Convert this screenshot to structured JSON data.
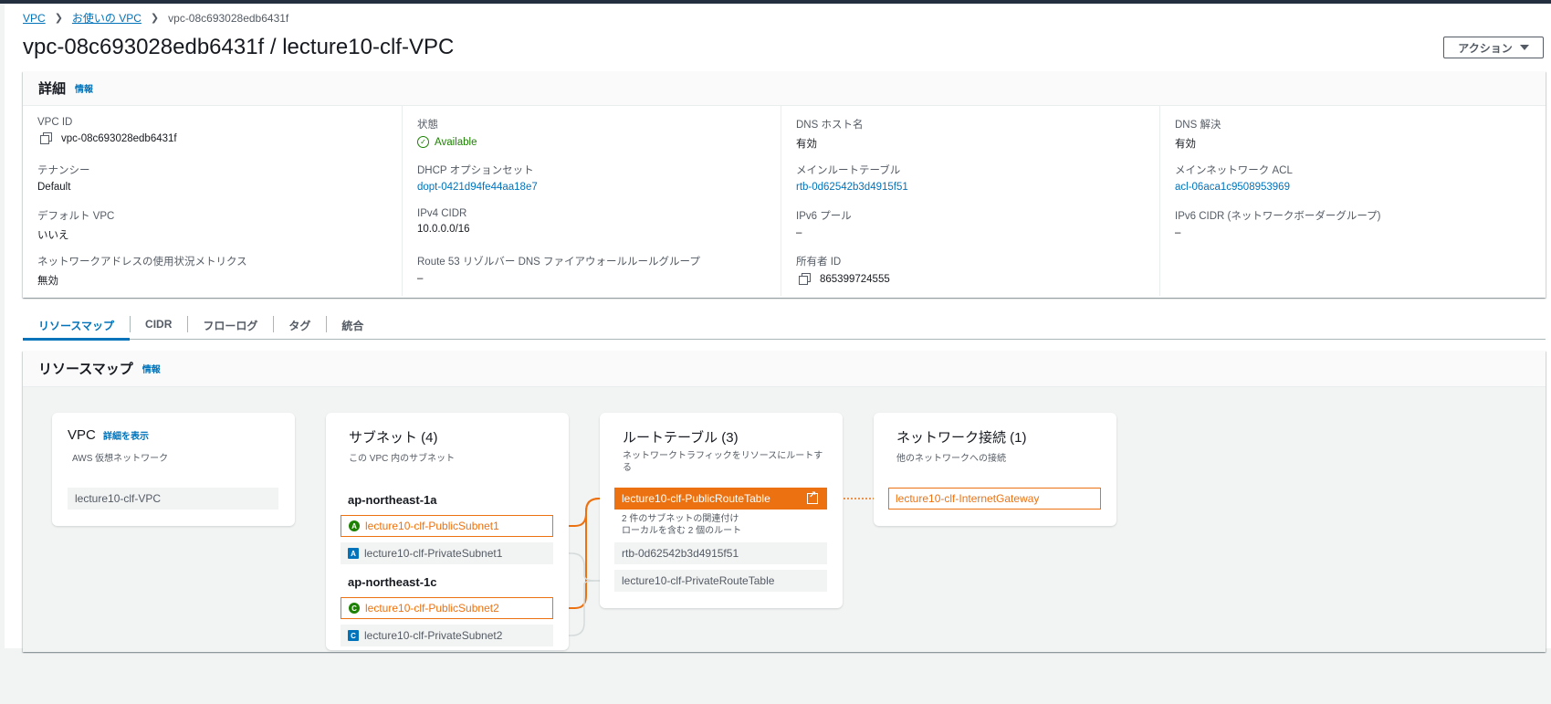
{
  "breadcrumb": {
    "root": "VPC",
    "parent": "お使いの VPC",
    "current": "vpc-08c693028edb6431f"
  },
  "page_title": "vpc-08c693028edb6431f / lecture10-clf-VPC",
  "actions_label": "アクション",
  "details": {
    "title": "詳細",
    "info": "情報",
    "columns": [
      [
        {
          "label": "VPC ID",
          "value": "vpc-08c693028edb6431f"
        },
        {
          "label": "テナンシー",
          "value": "Default"
        },
        {
          "label": "デフォルト VPC",
          "value": "いいえ"
        },
        {
          "label": "ネットワークアドレスの使用状況メトリクス",
          "value": "無効"
        }
      ],
      [
        {
          "label": "状態",
          "value": "Available"
        },
        {
          "label": "DHCP オプションセット",
          "value": "dopt-0421d94fe44aa18e7"
        },
        {
          "label": "IPv4 CIDR",
          "value": "10.0.0.0/16"
        },
        {
          "label": "Route 53 リゾルバー DNS ファイアウォールルールグループ",
          "value": "–"
        }
      ],
      [
        {
          "label": "DNS ホスト名",
          "value": "有効"
        },
        {
          "label": "メインルートテーブル",
          "value": "rtb-0d62542b3d4915f51"
        },
        {
          "label": "IPv6 プール",
          "value": "–"
        },
        {
          "label": "所有者 ID",
          "value": "865399724555"
        }
      ],
      [
        {
          "label": "DNS 解決",
          "value": "有効"
        },
        {
          "label": "メインネットワーク ACL",
          "value": "acl-06aca1c9508953969"
        },
        {
          "label": "IPv6 CIDR (ネットワークボーダーグループ)",
          "value": "–"
        }
      ]
    ]
  },
  "tabs": [
    "リソースマップ",
    "CIDR",
    "フローログ",
    "タグ",
    "統合"
  ],
  "resource_map": {
    "title": "リソースマップ",
    "info": "情報",
    "vpc": {
      "title": "VPC",
      "detail_link": "詳細を表示",
      "subtitle": "AWS 仮想ネットワーク",
      "item": "lecture10-clf-VPC"
    },
    "subnets": {
      "title": "サブネット (4)",
      "subtitle": "この VPC 内のサブネット",
      "az1": "ap-northeast-1a",
      "az1_badge": "A",
      "az1_public": "lecture10-clf-PublicSubnet1",
      "az1_private": "lecture10-clf-PrivateSubnet1",
      "az2": "ap-northeast-1c",
      "az2_badge": "C",
      "az2_public": "lecture10-clf-PublicSubnet2",
      "az2_private": "lecture10-clf-PrivateSubnet2"
    },
    "route_tables": {
      "title": "ルートテーブル (3)",
      "subtitle": "ネットワークトラフィックをリソースにルートする",
      "public": "lecture10-clf-PublicRouteTable",
      "meta1": "2 件のサブネットの関連付け",
      "meta2": "ローカルを含む 2 個のルート",
      "main": "rtb-0d62542b3d4915f51",
      "private": "lecture10-clf-PrivateRouteTable"
    },
    "network": {
      "title": "ネットワーク接続 (1)",
      "subtitle": "他のネットワークへの接続",
      "igw": "lecture10-clf-InternetGateway"
    }
  },
  "colors": {
    "accent": "#0073bb",
    "highlight": "#ec7211",
    "ok": "#1d8102"
  }
}
